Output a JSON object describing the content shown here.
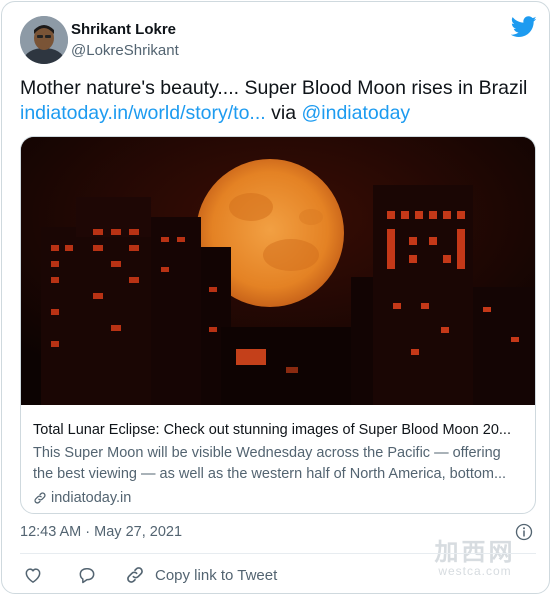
{
  "author": {
    "name": "Shrikant Lokre",
    "handle": "@LokreShrikant"
  },
  "tweet": {
    "text": "Mother nature's beauty.... Super Blood Moon rises in Brazil",
    "link_text": "indiatoday.in/world/story/to...",
    "via_text": "via",
    "mention": "@indiatoday"
  },
  "card": {
    "title": "Total Lunar Eclipse: Check out stunning images of Super Blood Moon 20...",
    "description_line1": "This Super Moon will be visible Wednesday across the Pacific — offering",
    "description_line2": "the best viewing — as well as the western half of North America, bottom...",
    "domain": "indiatoday.in"
  },
  "meta": {
    "time": "12:43 AM",
    "separator": " · ",
    "date": "May 27, 2021"
  },
  "actions": {
    "copy_label": "Copy link to Tweet"
  },
  "watermark": {
    "big": "加西网",
    "small": "westca.com"
  },
  "colors": {
    "accent": "#1d9bf0",
    "text": "#0f1419",
    "secondary": "#536471",
    "border": "#cfd9de",
    "moon": "#e88a28"
  },
  "icons": {
    "brand": "twitter-bird-icon",
    "info": "info-icon",
    "like": "heart-icon",
    "reply": "reply-bubble-icon",
    "copy": "link-icon"
  }
}
